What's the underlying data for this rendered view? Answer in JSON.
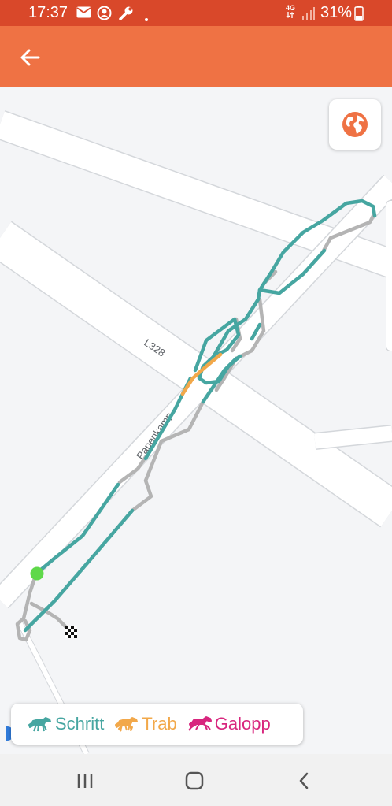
{
  "status_bar": {
    "time": "17:37",
    "network": "4G",
    "battery_percent": "31%",
    "icons": [
      "mail-icon",
      "account-circle-icon",
      "wrench-icon",
      "dot-icon",
      "signal-icon",
      "battery-icon"
    ]
  },
  "app_bar": {
    "back_icon": "arrow-left-icon"
  },
  "map": {
    "road_labels": {
      "main_road": "L328",
      "side_road": "Papenkamp"
    },
    "start_marker_color": "#5fd84a",
    "finish_marker": "checkered-flag-icon",
    "layers_button_icon": "globe-icon"
  },
  "legend": {
    "items": [
      {
        "label": "Schritt",
        "color": "#46a6a1",
        "icon": "horse-walk-icon"
      },
      {
        "label": "Trab",
        "color": "#f2a84a",
        "icon": "horse-trot-icon"
      },
      {
        "label": "Galopp",
        "color": "#d8267e",
        "icon": "horse-gallop-icon"
      }
    ]
  },
  "colors": {
    "status_bar": "#d9482a",
    "app_bar": "#ef7244",
    "route_walk": "#46a6a1",
    "route_trot": "#f2a84a",
    "route_gps_gap": "#b4b4b4"
  },
  "nav_bar": {
    "icons": [
      "recent-apps-icon",
      "home-icon",
      "back-nav-icon"
    ]
  }
}
